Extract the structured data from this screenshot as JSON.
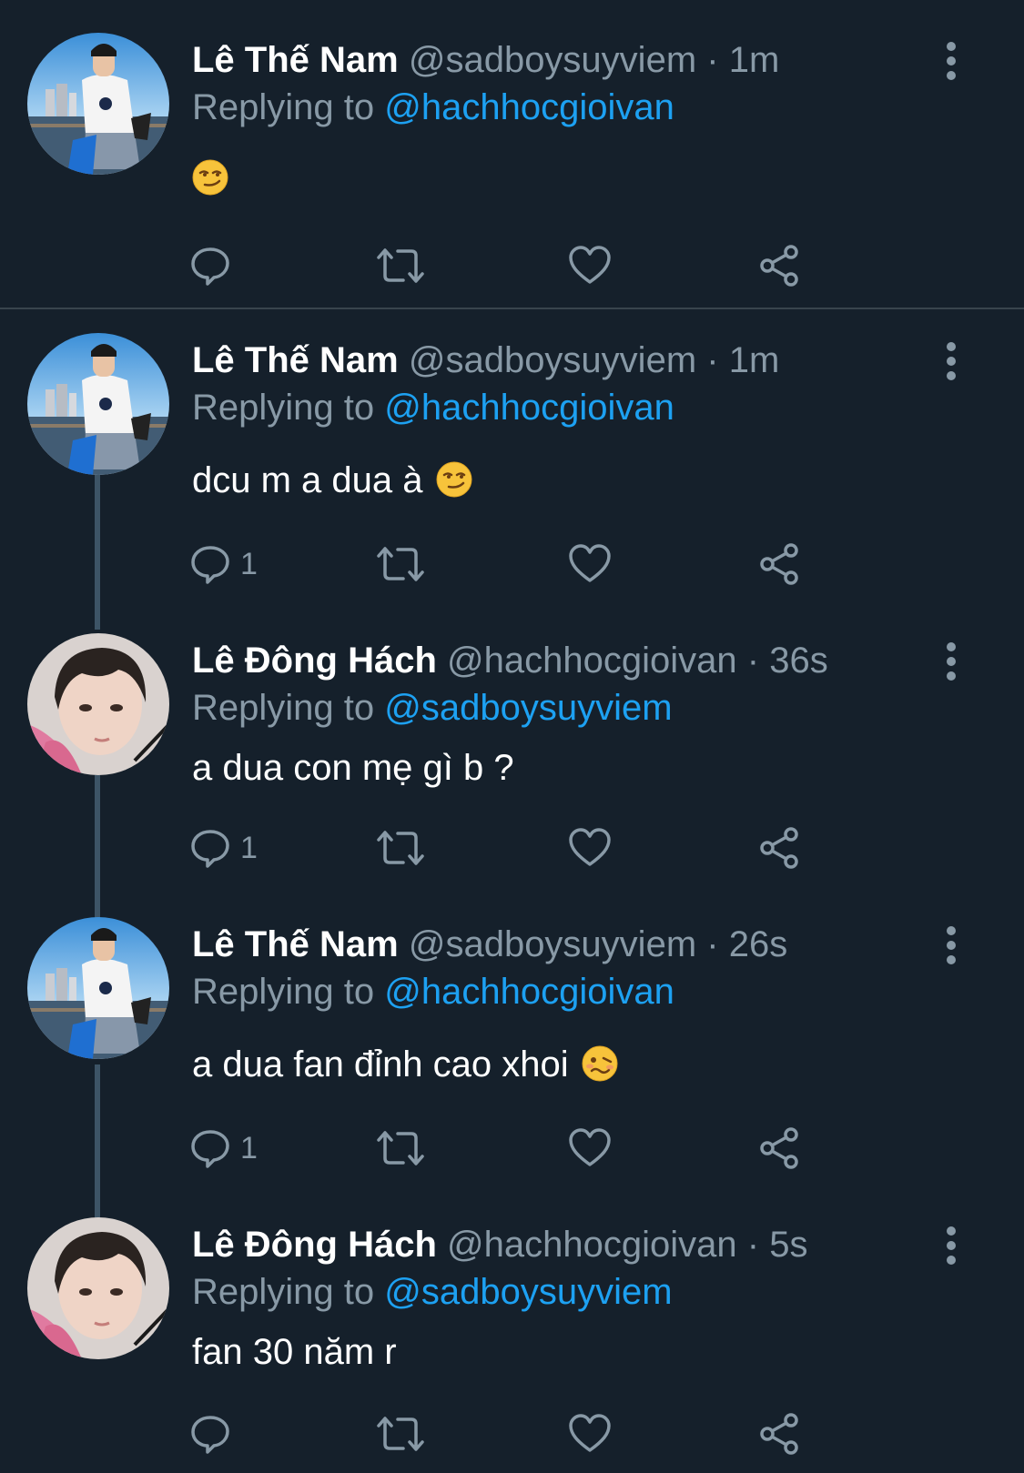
{
  "colors": {
    "background": "#15202b",
    "text": "#ffffff",
    "muted": "#8899a6",
    "mention": "#1da1f2",
    "divider": "#38444d",
    "thread_line": "#3d5466"
  },
  "labels": {
    "replying_to": "Replying to",
    "separator": "·"
  },
  "tweets": [
    {
      "name": "Lê Thế Nam",
      "handle": "@sadboysuyviem",
      "time": "1m",
      "replying_to": "@hachhocgioivan",
      "text": "",
      "emoji": "smirking-face-emoji",
      "reply_count": ""
    },
    {
      "name": "Lê Thế Nam",
      "handle": "@sadboysuyviem",
      "time": "1m",
      "replying_to": "@hachhocgioivan",
      "text": "dcu m a dua à",
      "emoji": "smirking-face-emoji",
      "reply_count": "1"
    },
    {
      "name": "Lê Đông Hách",
      "handle": "@hachhocgioivan",
      "time": "36s",
      "replying_to": "@sadboysuyviem",
      "text": "a dua con mẹ gì b ?",
      "emoji": "",
      "reply_count": "1"
    },
    {
      "name": "Lê Thế Nam",
      "handle": "@sadboysuyviem",
      "time": "26s",
      "replying_to": "@hachhocgioivan",
      "text": "a dua fan đỉnh cao xhoi",
      "emoji": "woozy-face-emoji",
      "reply_count": "1"
    },
    {
      "name": "Lê Đông Hách",
      "handle": "@hachhocgioivan",
      "time": "5s",
      "replying_to": "@sadboysuyviem",
      "text": "fan 30 năm r",
      "emoji": "",
      "reply_count": ""
    }
  ]
}
